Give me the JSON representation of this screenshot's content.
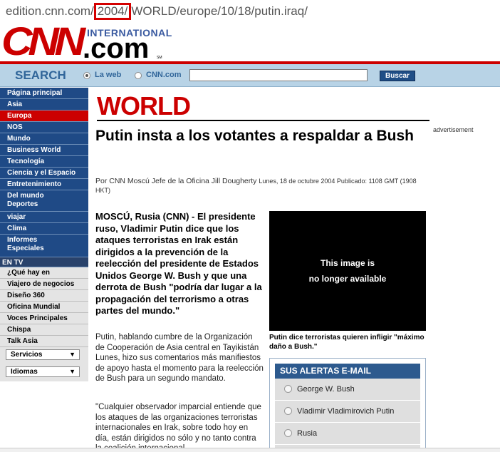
{
  "url": {
    "prefix": "edition.cnn.com/",
    "highlight": "2004/",
    "suffix": "WORLD/europe/10/18/putin.iraq/"
  },
  "header": {
    "logo_text": "CNN",
    "international": "INTERNATIONAL",
    "dotcom": ".com",
    "sm_mark": "SM"
  },
  "search": {
    "title": "SEARCH",
    "option_web": "La web",
    "option_cnn": "CNN.com",
    "input_value": "",
    "button_label": "Buscar"
  },
  "sidebar": {
    "nav": [
      {
        "label": "Página principal"
      },
      {
        "label": "Asia"
      },
      {
        "label": "Europa"
      },
      {
        "label": "NOS"
      },
      {
        "label": "Mundo"
      },
      {
        "label": "Business World"
      },
      {
        "label": "Tecnología"
      },
      {
        "label": "Ciencia y el Espacio"
      },
      {
        "label": "Entretenimiento"
      },
      {
        "label": "Del mundo Deportes"
      },
      {
        "label": "viajar"
      },
      {
        "label": "Clima"
      },
      {
        "label": "Informes Especiales"
      }
    ],
    "tv_label": "EN TV",
    "tv_items": [
      {
        "label": "¿Qué hay en"
      },
      {
        "label": "Viajero de negocios"
      },
      {
        "label": "Diseño 360"
      },
      {
        "label": "Oficina Mundial"
      },
      {
        "label": "Voces Principales"
      },
      {
        "label": "Chispa"
      },
      {
        "label": "Talk Asia"
      }
    ],
    "select_services": "Servicios",
    "select_languages": "Idiomas"
  },
  "article": {
    "section": "WORLD",
    "advertisement": "advertisement",
    "headline": "Putin insta a los votantes a respaldar a Bush",
    "byline": "Por CNN Moscú Jefe de la Oficina Jill Dougherty",
    "date": "Lunes, 18 de octubre 2004 Publicado: 1108 GMT (1908 HKT)",
    "lead": "MOSCÚ, Rusia (CNN) - El presidente ruso, Vladimir Putin dice que los ataques terroristas en Irak están dirigidos a la prevención de la reelección del presidente de Estados Unidos George W. Bush y que una derrota de Bush \"podría dar lugar a la propagación del terrorismo a otras partes del mundo.\"",
    "paragraph1": "Putin, hablando cumbre de la Organización de Cooperación de Asia central en Tayikistán Lunes, hizo sus comentarios más manifiestos de apoyo hasta el momento para la reelección de Bush para un segundo mandato.",
    "paragraph2": "\"Cualquier observador imparcial entiende que los ataques de las organizaciones terroristas internacionales en Irak, sobre todo hoy en día, están dirigidos no sólo y no tanto contra la coalición internacional"
  },
  "image": {
    "message_line1": "This image is",
    "message_line2": "no longer available",
    "caption": "Putin dice terroristas quieren infligir \"máximo daño a Bush.\""
  },
  "alerts": {
    "title": "SUS ALERTAS E-MAIL",
    "items": [
      {
        "label": "George W. Bush"
      },
      {
        "label": "Vladimir Vladimirovich Putin"
      },
      {
        "label": "Rusia"
      }
    ]
  }
}
